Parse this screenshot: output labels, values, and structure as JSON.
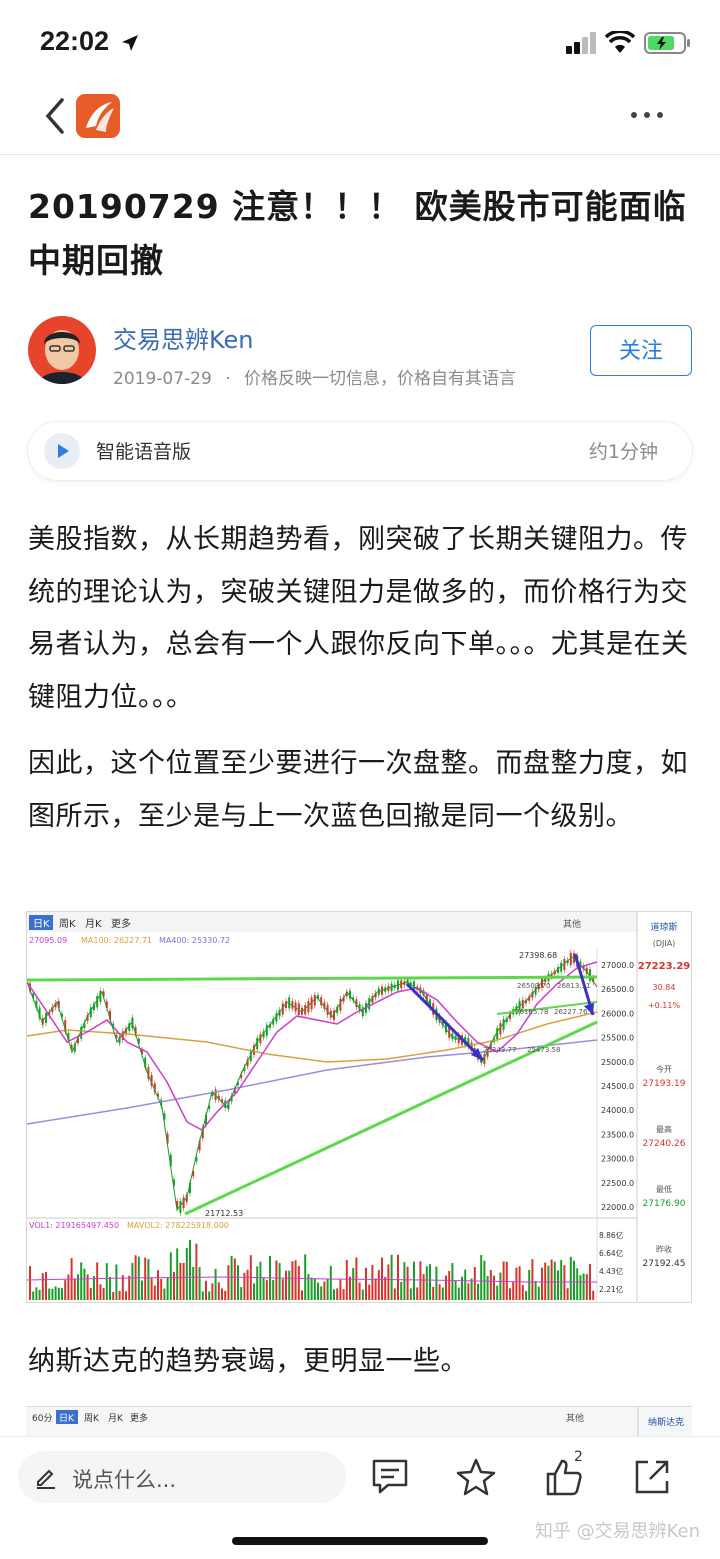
{
  "status_bar": {
    "time": "22:02"
  },
  "article": {
    "title": "20190729 注意！！！ 欧美股市可能面临中期回撤",
    "author": {
      "name": "交易思辨Ken",
      "date": "2019-07-29",
      "separator": "·",
      "bio": "价格反映一切信息，价格自有其语言"
    },
    "follow_label": "关注",
    "audio": {
      "label": "智能语音版",
      "duration": "约1分钟"
    },
    "paragraphs": [
      "美股指数，从长期趋势看，刚突破了长期关键阻力。传统的理论认为，突破关键阻力是做多的，而价格行为交易者认为，总会有一个人跟你反向下单。。。尤其是在关键阻力位。。。",
      "因此，这个位置至少要进行一次盘整。而盘整力度，如图所示，至少是与上一次蓝色回撤是同一个级别。",
      "纳斯达克的趋势衰竭，更明显一些。"
    ]
  },
  "chart1": {
    "tabs": [
      "日K",
      "周K",
      "月K",
      "更多"
    ],
    "tools_label": "其他",
    "ma_line": {
      "ma_a": "27095.09",
      "ma100": "MA100: 26227.71",
      "ma400": "MA400: 25330.72"
    },
    "price_ticks": [
      "27000.0",
      "26500.0",
      "26000.0",
      "25500.0",
      "25000.0",
      "24500.0",
      "24000.0",
      "23500.0",
      "23000.0",
      "22500.0",
      "22000.0"
    ],
    "labels": {
      "high": "27398.68",
      "low": "21712.53",
      "l1": "26503.70",
      "l2": "26813.11",
      "l3": "26165.78",
      "l4": "26227.76",
      "l5": "25343.77",
      "l6": "25473.58"
    },
    "vol_line": {
      "a": "VOL1: 219165497.450",
      "b": "MAVOL2: 278225918.000"
    },
    "vol_ticks": [
      "8.86亿",
      "6.64亿",
      "4.43亿",
      "2.21亿"
    ],
    "side": {
      "name": "道琼斯",
      "code": "(DJIA)",
      "price": "27223.29",
      "change": "30.84",
      "pct": "+0.11%",
      "open_label": "今开",
      "open": "27193.19",
      "high_label": "最高",
      "high": "27240.26",
      "low_label": "最低",
      "low": "27176.90",
      "prev_label": "昨收",
      "prev": "27192.45"
    },
    "colors": {
      "green_line": "#5cd84a",
      "blue_arrow": "#3b2fc9",
      "ma_pink": "#d23ad0",
      "ma_orange": "#d9a040",
      "ma_purple": "#9b8be0",
      "up": "#d9342b",
      "down": "#1a9e2a"
    }
  },
  "chart2": {
    "tabs": [
      "60分",
      "日K",
      "周K",
      "月K",
      "更多"
    ],
    "tools_label": "其他",
    "side_name": "纳斯达克"
  },
  "bottom_bar": {
    "comment_placeholder": "说点什么...",
    "like_count": "2",
    "watermark": "知乎 @交易思辨Ken"
  }
}
